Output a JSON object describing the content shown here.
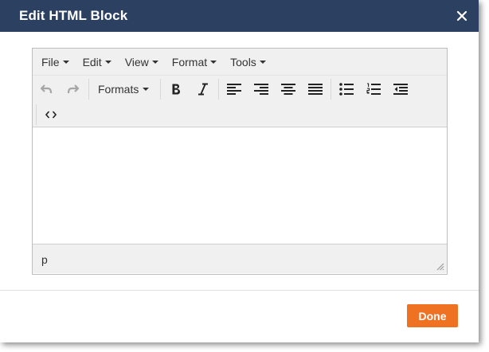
{
  "dialog": {
    "title": "Edit HTML Block",
    "close_icon": "close-icon"
  },
  "menubar": {
    "items": [
      {
        "label": "File"
      },
      {
        "label": "Edit"
      },
      {
        "label": "View"
      },
      {
        "label": "Format"
      },
      {
        "label": "Tools"
      }
    ]
  },
  "toolbar": {
    "formats_label": "Formats",
    "icons": [
      "undo-icon",
      "redo-icon",
      "bold-icon",
      "italic-icon",
      "align-left-icon",
      "align-right-icon",
      "align-center-icon",
      "align-justify-icon",
      "bullet-list-icon",
      "numbered-list-icon",
      "outdent-icon",
      "source-code-icon"
    ],
    "disabled_color": "#a6a6a6",
    "icon_color": "#222222"
  },
  "statusbar": {
    "path": "p"
  },
  "footer": {
    "done_label": "Done",
    "accent": "#ef7122"
  },
  "colors": {
    "header_bg": "#2c4161",
    "toolbar_bg": "#f0f0f0"
  }
}
